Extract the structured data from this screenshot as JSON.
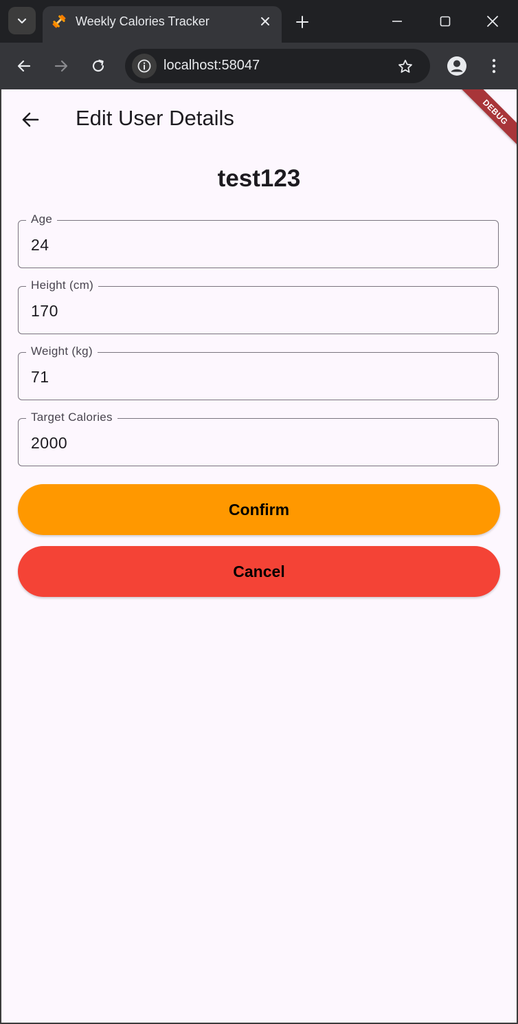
{
  "browser": {
    "tab_title": "Weekly Calories Tracker",
    "url": "localhost:58047",
    "colors": {
      "frame": "#202124",
      "toolbar": "#35363a",
      "text": "#e8eaed"
    }
  },
  "app": {
    "appbar_title": "Edit User Details",
    "debug_banner": "DEBUG",
    "username": "test123",
    "fields": [
      {
        "label": "Age",
        "value": "24"
      },
      {
        "label": "Height (cm)",
        "value": "170"
      },
      {
        "label": "Weight (kg)",
        "value": "71"
      },
      {
        "label": "Target Calories",
        "value": "2000"
      }
    ],
    "confirm_label": "Confirm",
    "cancel_label": "Cancel",
    "colors": {
      "background": "#fdf7fe",
      "confirm": "#ff9800",
      "cancel": "#f44336",
      "outline": "#79747e"
    }
  }
}
